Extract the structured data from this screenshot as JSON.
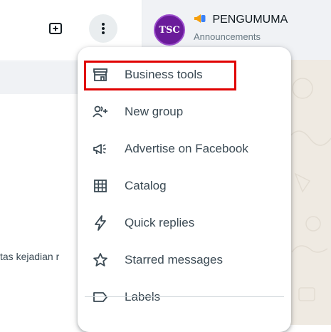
{
  "left_panel": {
    "preview_text": "tas kejadian r"
  },
  "chat_header": {
    "title": "PENGUMUMA",
    "subtitle": "Announcements",
    "avatar_text": "TSC"
  },
  "menu": {
    "items": [
      {
        "label": "Business tools",
        "icon": "storefront-icon",
        "highlighted": true
      },
      {
        "label": "New group",
        "icon": "add-group-icon"
      },
      {
        "label": "Advertise on Facebook",
        "icon": "megaphone-icon"
      },
      {
        "label": "Catalog",
        "icon": "grid-catalog-icon"
      },
      {
        "label": "Quick replies",
        "icon": "lightning-icon"
      },
      {
        "label": "Starred messages",
        "icon": "star-icon"
      },
      {
        "label": "Labels",
        "icon": "label-tag-icon"
      }
    ]
  },
  "colors": {
    "highlight_border": "#e00000",
    "menu_text": "#3b4a54",
    "avatar_bg": "#6a1b9a"
  }
}
